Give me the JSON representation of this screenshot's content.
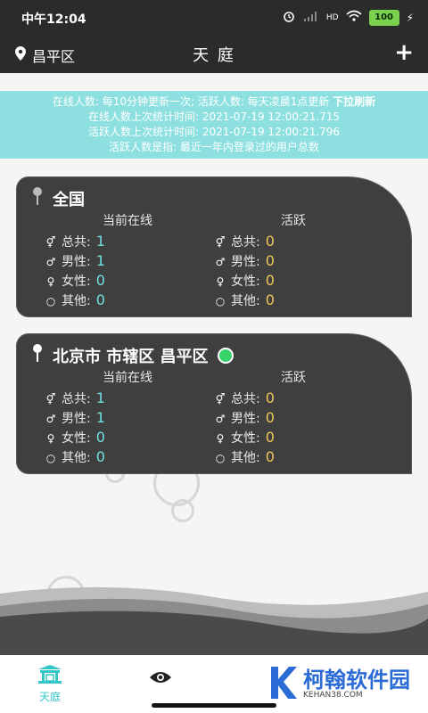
{
  "status_bar": {
    "time": "中午12:04",
    "hd": "HD",
    "battery": "100"
  },
  "app_bar": {
    "location": "昌平区",
    "title": "天 庭",
    "add_label": "+"
  },
  "banner": {
    "line1_text": "在线人数: 每10分钟更新一次; 活跃人数: 每天凌晨1点更新",
    "line1_pull": "下拉刷新",
    "line2": "在线人数上次统计时间: 2021-07-19 12:00:21.715",
    "line3": "活跃人数上次统计时间: 2021-07-19 12:00:21.796",
    "line4": "活跃人数是指: 最近一年内登录过的用户总数"
  },
  "cards": [
    {
      "title": "全国",
      "online_header": "当前在线",
      "active_header": "活跃",
      "online": {
        "total_label": "总共:",
        "total": "1",
        "male_label": "男性:",
        "male": "1",
        "female_label": "女性:",
        "female": "0",
        "other_label": "其他:",
        "other": "0"
      },
      "active": {
        "total_label": "总共:",
        "total": "0",
        "male_label": "男性:",
        "male": "0",
        "female_label": "女性:",
        "female": "0",
        "other_label": "其他:",
        "other": "0"
      }
    },
    {
      "title": "北京市 市辖区 昌平区",
      "online_header": "当前在线",
      "active_header": "活跃",
      "online": {
        "total_label": "总共:",
        "total": "1",
        "male_label": "男性:",
        "male": "1",
        "female_label": "女性:",
        "female": "0",
        "other_label": "其他:",
        "other": "0"
      },
      "active": {
        "total_label": "总共:",
        "total": "0",
        "male_label": "男性:",
        "male": "0",
        "female_label": "女性:",
        "female": "0",
        "other_label": "其他:",
        "other": "0"
      }
    }
  ],
  "tabs": [
    {
      "label": "天庭",
      "icon": "temple-icon",
      "active": true
    },
    {
      "label": "",
      "icon": "eye-icon",
      "active": false
    }
  ],
  "watermark": {
    "text": "柯翰软件园",
    "sub": "KEHAN38.COM"
  },
  "colors": {
    "dark_bar": "#2b2b2b",
    "banner": "#8de0df",
    "card_bg": "#3f3f3f",
    "online_value": "#6fe0e0",
    "active_value": "#f0c85a",
    "accent": "#35c7c7"
  }
}
